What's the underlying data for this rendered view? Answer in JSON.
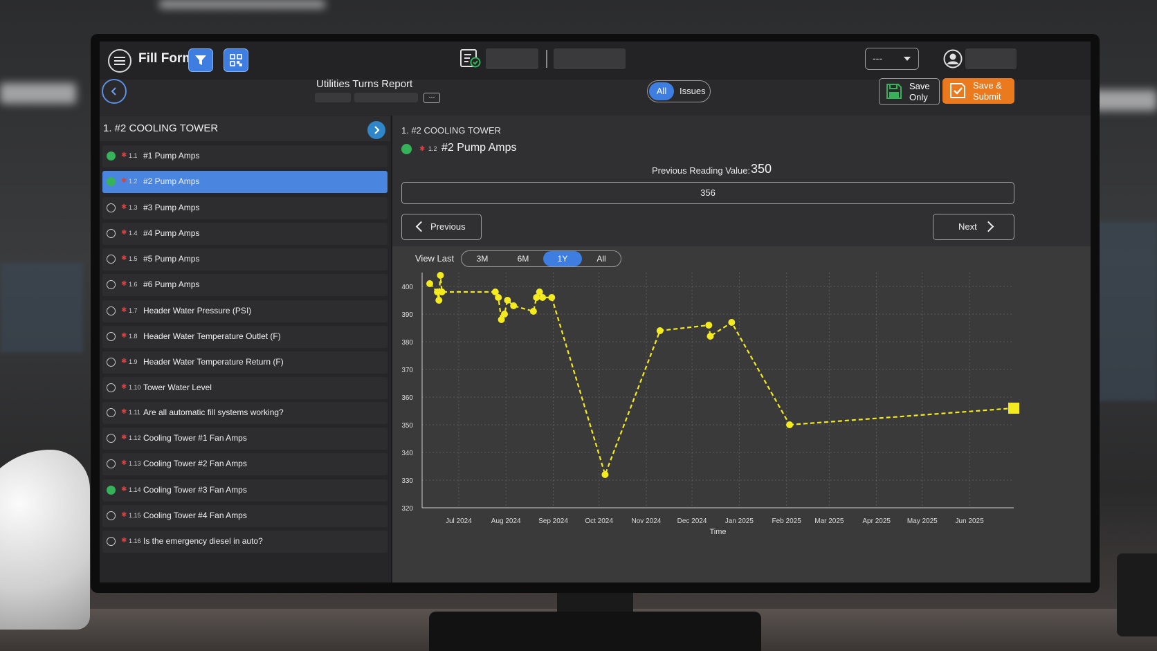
{
  "header": {
    "app_title": "Fill Form",
    "status_dropdown": "---",
    "colors": {
      "accent": "#3e7ee0",
      "submit": "#ea7a1d",
      "complete": "#36b25a",
      "required": "#d94040",
      "series": "#f3ea1f"
    }
  },
  "subheader": {
    "report_title": "Utilities Turns Report",
    "small_tag": "---",
    "filter_all": "All",
    "filter_issues": "Issues",
    "save_only_line1": "Save",
    "save_only_line2": "Only",
    "save_submit_line1": "Save &",
    "save_submit_line2": "Submit"
  },
  "sidebar": {
    "section_title": "1. #2 COOLING TOWER",
    "items": [
      {
        "num": "1.1",
        "label": "#1 Pump Amps",
        "done": true
      },
      {
        "num": "1.2",
        "label": "#2 Pump Amps",
        "done": true,
        "active": true
      },
      {
        "num": "1.3",
        "label": "#3 Pump Amps",
        "done": false
      },
      {
        "num": "1.4",
        "label": "#4 Pump Amps",
        "done": false
      },
      {
        "num": "1.5",
        "label": "#5 Pump Amps",
        "done": false
      },
      {
        "num": "1.6",
        "label": "#6 Pump Amps",
        "done": false
      },
      {
        "num": "1.7",
        "label": "Header Water Pressure (PSI)",
        "done": false
      },
      {
        "num": "1.8",
        "label": "Header Water Temperature Outlet (F)",
        "done": false
      },
      {
        "num": "1.9",
        "label": "Header Water Temperature Return (F)",
        "done": false
      },
      {
        "num": "1.10",
        "label": "Tower Water Level",
        "done": false
      },
      {
        "num": "1.11",
        "label": "Are all automatic fill systems working?",
        "done": false
      },
      {
        "num": "1.12",
        "label": "Cooling Tower #1 Fan Amps",
        "done": false
      },
      {
        "num": "1.13",
        "label": "Cooling Tower #2 Fan Amps",
        "done": false
      },
      {
        "num": "1.14",
        "label": "Cooling Tower #3 Fan Amps",
        "done": true
      },
      {
        "num": "1.15",
        "label": "Cooling Tower #4 Fan Amps",
        "done": false
      },
      {
        "num": "1.16",
        "label": "Is the emergency diesel in auto?",
        "done": false
      }
    ]
  },
  "main": {
    "breadcrumb": "1. #2 COOLING TOWER",
    "item_num": "1.2",
    "item_label": "#2 Pump Amps",
    "previous_label": "Previous Reading Value:",
    "previous_value": "350",
    "reading_value": "356",
    "prev_button": "Previous",
    "next_button": "Next",
    "view_last_label": "View Last",
    "ranges": [
      "3M",
      "6M",
      "1Y",
      "All"
    ],
    "selected_range": "1Y"
  },
  "chart_data": {
    "type": "line",
    "xlabel": "Time",
    "ylabel": "",
    "ylim": [
      320,
      405
    ],
    "yticks": [
      320,
      330,
      340,
      350,
      360,
      370,
      380,
      390,
      400
    ],
    "xticks": [
      "Jul 2024",
      "Aug 2024",
      "Sep 2024",
      "Oct 2024",
      "Nov 2024",
      "Dec 2024",
      "Jan 2025",
      "Feb 2025",
      "Mar 2025",
      "Apr 2025",
      "May 2025",
      "Jun 2025"
    ],
    "xrange": [
      "2024-06-07",
      "2025-06-30"
    ],
    "grid": true,
    "series": [
      {
        "points": [
          [
            "2024-06-12",
            401
          ],
          [
            "2024-06-17",
            398
          ],
          [
            "2024-06-18",
            395
          ],
          [
            "2024-06-19",
            404
          ],
          [
            "2024-06-20",
            398
          ],
          [
            "2024-07-25",
            398
          ],
          [
            "2024-07-27",
            396
          ],
          [
            "2024-07-29",
            388
          ],
          [
            "2024-07-31",
            390
          ],
          [
            "2024-08-02",
            395
          ],
          [
            "2024-08-06",
            393
          ],
          [
            "2024-08-19",
            391
          ],
          [
            "2024-08-21",
            396
          ],
          [
            "2024-08-23",
            398
          ],
          [
            "2024-08-25",
            396
          ],
          [
            "2024-08-31",
            396
          ],
          [
            "2024-10-05",
            332
          ],
          [
            "2024-11-10",
            384
          ],
          [
            "2024-12-12",
            386
          ],
          [
            "2024-12-13",
            382
          ],
          [
            "2024-12-27",
            387
          ],
          [
            "2025-02-03",
            350
          ]
        ],
        "dashed": true
      },
      {
        "points": [
          [
            "2025-02-03",
            350
          ],
          [
            "2025-06-30",
            356
          ]
        ],
        "dashed": true,
        "current": true
      }
    ]
  }
}
